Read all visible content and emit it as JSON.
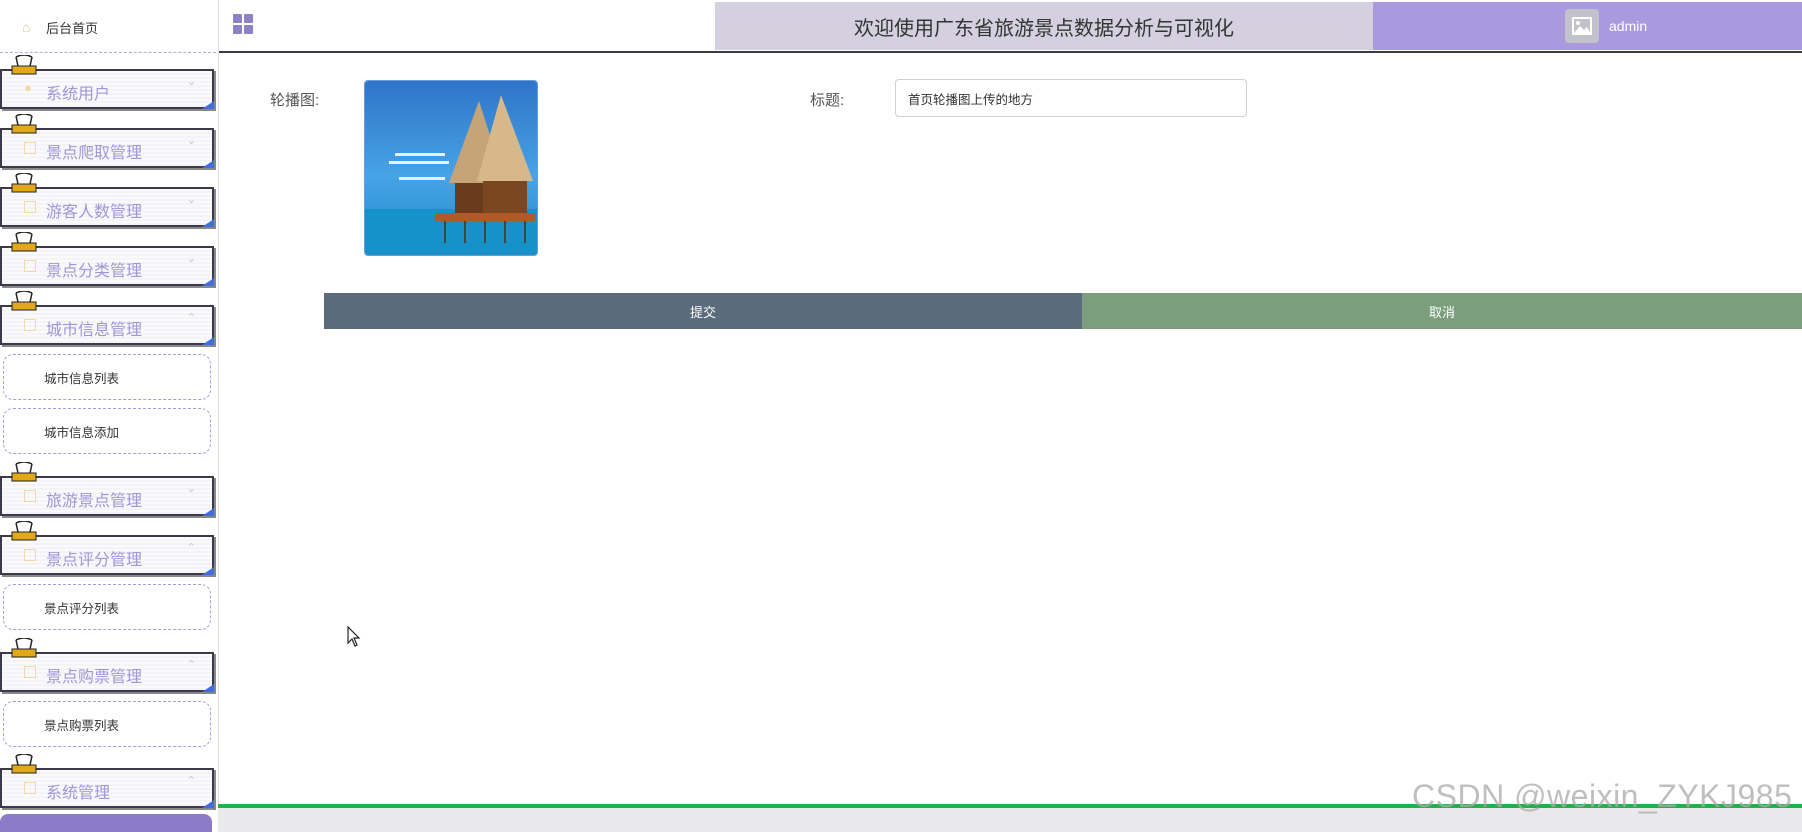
{
  "sidebar": {
    "home_label": "后台首页",
    "groups": [
      {
        "label": "系统用户"
      },
      {
        "label": "景点爬取管理"
      },
      {
        "label": "游客人数管理"
      },
      {
        "label": "景点分类管理"
      },
      {
        "label": "城市信息管理",
        "items": [
          "城市信息列表",
          "城市信息添加"
        ]
      },
      {
        "label": "旅游景点管理"
      },
      {
        "label": "景点评分管理",
        "items": [
          "景点评分列表"
        ]
      },
      {
        "label": "景点购票管理",
        "items": [
          "景点购票列表"
        ]
      },
      {
        "label": "系统管理"
      }
    ]
  },
  "header": {
    "title": "欢迎使用广东省旅游景点数据分析与可视化",
    "username": "admin"
  },
  "form": {
    "image_label": "轮播图:",
    "title_label": "标题:",
    "title_value": "首页轮播图上传的地方",
    "submit_label": "提交",
    "cancel_label": "取消"
  },
  "watermark": "CSDN @weixin_ZYKJ985",
  "colors": {
    "accent": "#a99ae0",
    "title_bg": "#d4d0e0",
    "submit": "#5a6b7b",
    "cancel": "#7b9e7c",
    "status_line": "#20b24a"
  }
}
